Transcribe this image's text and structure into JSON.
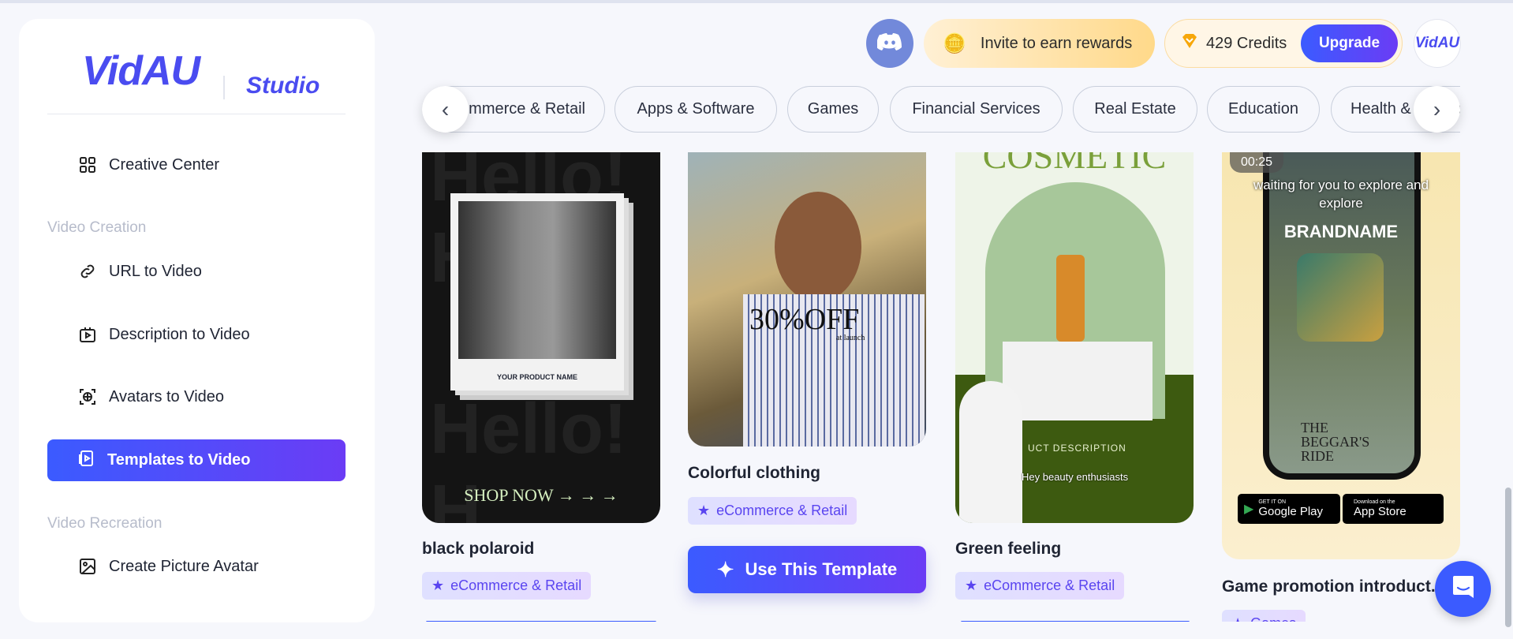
{
  "sidebar": {
    "logo": "VidAU",
    "logo_suffix": "Studio",
    "items": [
      {
        "label": "Creative Center",
        "icon": "grid-icon"
      },
      {
        "label": "URL to Video",
        "icon": "link-icon"
      },
      {
        "label": "Description to Video",
        "icon": "video-doc-icon"
      },
      {
        "label": "Avatars to Video",
        "icon": "avatar-scan-icon"
      },
      {
        "label": "Templates to Video",
        "icon": "template-icon",
        "active": true
      },
      {
        "label": "Create Picture Avatar",
        "icon": "image-icon"
      }
    ],
    "sections": [
      "Video Creation",
      "Video Recreation"
    ]
  },
  "header": {
    "invite": "Invite to earn rewards",
    "credits": "429 Credits",
    "upgrade": "Upgrade",
    "avatar": "VidAU"
  },
  "categories": [
    "eCommerce & Retail",
    "Apps & Software",
    "Games",
    "Financial Services",
    "Real Estate",
    "Education",
    "Health & Fitness"
  ],
  "cards": [
    {
      "title": "black polaroid",
      "tag": "eCommerce & Retail",
      "overlay": "SHOP NOW → → →",
      "product": "YOUR PRODUCT NAME"
    },
    {
      "title": "Colorful clothing",
      "tag": "eCommerce & Retail",
      "overlay": "30%OFF",
      "sub": "at launch",
      "button": "Use This Template"
    },
    {
      "title": "Green feeling",
      "tag": "eCommerce & Retail",
      "overlay": "COSMETIC",
      "desc": "UCT DESCRIPTION",
      "caption": "Hey beauty enthusiasts"
    },
    {
      "title": "Game promotion introduct...",
      "tag": "Games",
      "duration": "00:25",
      "caption": "waiting for you to explore and explore",
      "brand": "BRANDNAME",
      "game": "THE BEGGAR'S RIDE",
      "google": "Google Play",
      "google_small": "GET IT ON",
      "apple": "App Store",
      "apple_small": "Download on the"
    }
  ],
  "colors": {
    "accent": "#3b5bff",
    "accent2": "#6b3cf5",
    "discord": "#7289da",
    "chat": "#3b5bff"
  }
}
